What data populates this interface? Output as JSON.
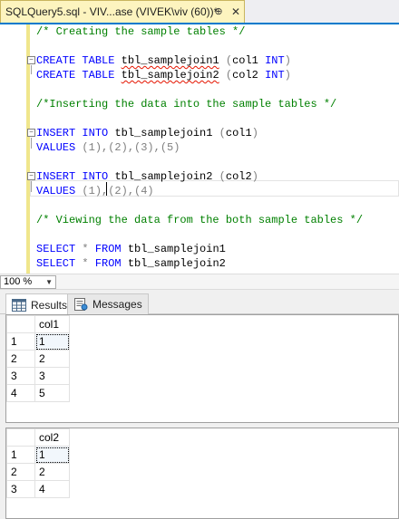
{
  "tab": {
    "title": "SQLQuery5.sql - VIV...ase (VIVEK\\viv (60))*",
    "pin_glyph": "⊕",
    "close_glyph": "✕"
  },
  "editor": {
    "lines": [
      {
        "text": "/* Creating the sample tables */"
      },
      {
        "text": ""
      },
      {
        "parts": [
          "CREATE",
          " ",
          "TABLE",
          " ",
          "tbl_samplejoin1",
          " ",
          "(",
          "col1",
          " ",
          "INT",
          ")"
        ]
      },
      {
        "parts": [
          "CREATE",
          " ",
          "TABLE",
          " ",
          "tbl_samplejoin2",
          " ",
          "(",
          "col2",
          " ",
          "INT",
          ")"
        ]
      },
      {
        "text": ""
      },
      {
        "text": "/*Inserting the data into the sample tables */"
      },
      {
        "text": ""
      },
      {
        "parts": [
          "INSERT",
          " ",
          "INTO",
          " ",
          "tbl_samplejoin1",
          " ",
          "(",
          "col1",
          ")"
        ]
      },
      {
        "parts": [
          "VALUES",
          " ",
          "(1),(2),(3),(5)"
        ]
      },
      {
        "text": ""
      },
      {
        "parts": [
          "INSERT",
          " ",
          "INTO",
          " ",
          "tbl_samplejoin2",
          " ",
          "(",
          "col2",
          ")"
        ]
      },
      {
        "parts": [
          "VALUES",
          " ",
          "(1),(2),(4)"
        ]
      },
      {
        "text": ""
      },
      {
        "text": "/* Viewing the data from the both sample tables */"
      },
      {
        "text": ""
      },
      {
        "parts": [
          "SELECT",
          " * ",
          "FROM",
          " ",
          "tbl_samplejoin1"
        ]
      },
      {
        "parts": [
          "SELECT",
          " * ",
          "FROM",
          " ",
          "tbl_samplejoin2"
        ]
      }
    ]
  },
  "zoom": {
    "value": "100 %"
  },
  "result_tabs": {
    "results": "Results",
    "messages": "Messages"
  },
  "grid1": {
    "header": "col1",
    "rows": [
      {
        "num": "1",
        "val": "1"
      },
      {
        "num": "2",
        "val": "2"
      },
      {
        "num": "3",
        "val": "3"
      },
      {
        "num": "4",
        "val": "5"
      }
    ]
  },
  "grid2": {
    "header": "col2",
    "rows": [
      {
        "num": "1",
        "val": "1"
      },
      {
        "num": "2",
        "val": "2"
      },
      {
        "num": "3",
        "val": "4"
      }
    ]
  },
  "colors": {
    "keyword": "#0000ff",
    "comment": "#008000",
    "tab_active": "#fdf4bf",
    "accent": "#007acc"
  }
}
